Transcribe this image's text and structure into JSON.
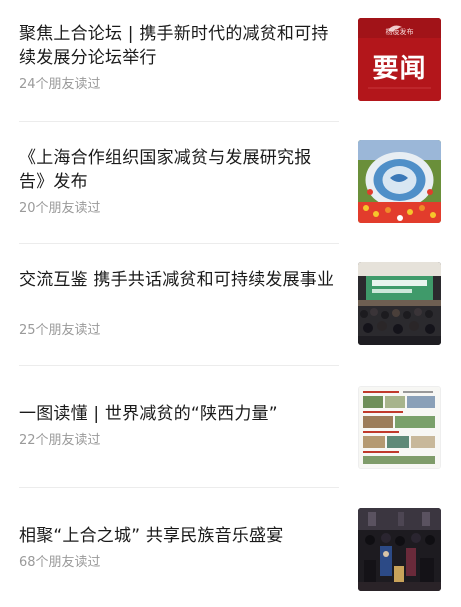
{
  "articles": [
    {
      "title": "聚焦上合论坛 | 携手新时代的减贫和可持续发展分论坛举行",
      "reads": "24个朋友读过",
      "thumb": "yaowen-thumbnail",
      "thumb_text": "要闻",
      "thumb_small_text": "杨凌发布"
    },
    {
      "title": "《上海合作组织国家减贫与发展研究报告》发布",
      "reads": "20个朋友读过",
      "thumb": "sco-emblem-flowerbed-photo"
    },
    {
      "title": "交流互鉴 携手共话减贫和可持续发展事业",
      "reads": "25个朋友读过",
      "thumb": "forum-hall-photo"
    },
    {
      "title": "一图读懂 | 世界减贫的“陕西力量”",
      "reads": "22个朋友读过",
      "thumb": "infographic-thumbnail"
    },
    {
      "title": "相聚“上合之城” 共享民族音乐盛宴",
      "reads": "68个朋友读过",
      "thumb": "orchestra-performance-photo"
    }
  ],
  "colors": {
    "title": "#1a1a1a",
    "reads": "#9a9a9a",
    "divider": "#ececec",
    "yaowen_red": "#b3161b"
  }
}
